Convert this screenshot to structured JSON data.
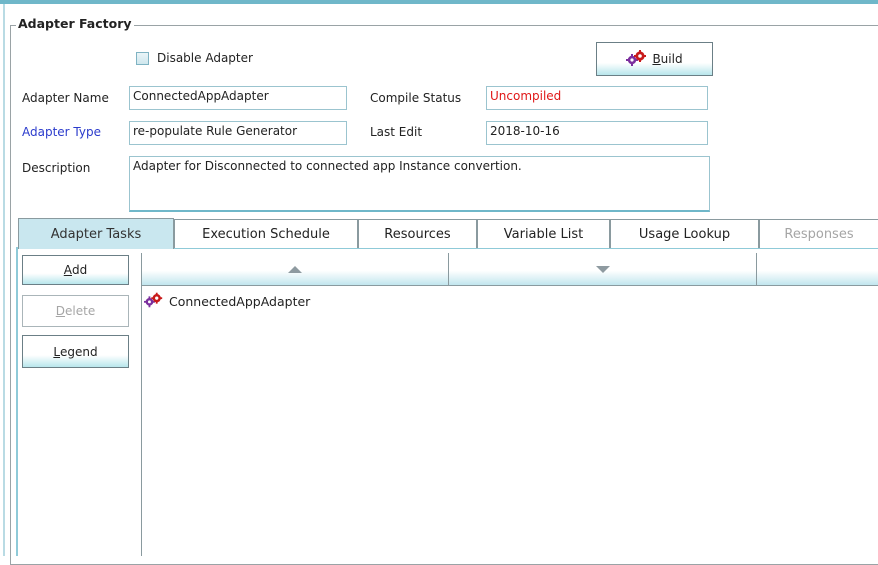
{
  "section_title": "Adapter Factory",
  "disable_adapter": {
    "label": "Disable Adapter",
    "checked": false
  },
  "build_button": {
    "icon": "gears-icon",
    "label_underlined": "B",
    "label_rest": "uild"
  },
  "fields": {
    "adapter_name_label": "Adapter Name",
    "adapter_name_value": "ConnectedAppAdapter",
    "compile_status_label": "Compile Status",
    "compile_status_value": "Uncompiled",
    "adapter_type_label": "Adapter Type",
    "adapter_type_value": "re-populate Rule Generator",
    "last_edit_label": "Last Edit",
    "last_edit_value": "2018-10-16",
    "description_label": "Description",
    "description_value": "Adapter for Disconnected to connected app Instance convertion."
  },
  "tabs": [
    {
      "label": "Adapter Tasks",
      "state": "active"
    },
    {
      "label": "Execution Schedule",
      "state": "normal"
    },
    {
      "label": "Resources",
      "state": "normal"
    },
    {
      "label": "Variable List",
      "state": "normal"
    },
    {
      "label": "Usage Lookup",
      "state": "normal"
    },
    {
      "label": "Responses",
      "state": "disabled"
    }
  ],
  "side_buttons": {
    "add_u": "A",
    "add_rest": "dd",
    "delete_u": "D",
    "delete_rest": "elete",
    "legend_u": "L",
    "legend_rest": "egend"
  },
  "tree_header": {
    "up_icon": "triangle-up-icon",
    "down_icon": "triangle-down-icon"
  },
  "tree_items": [
    {
      "label": "ConnectedAppAdapter",
      "icon": "gears-icon"
    }
  ],
  "colors": {
    "accent": "#8fcad8",
    "status_red": "#e01818",
    "type_label_blue": "#2b3bcc"
  }
}
